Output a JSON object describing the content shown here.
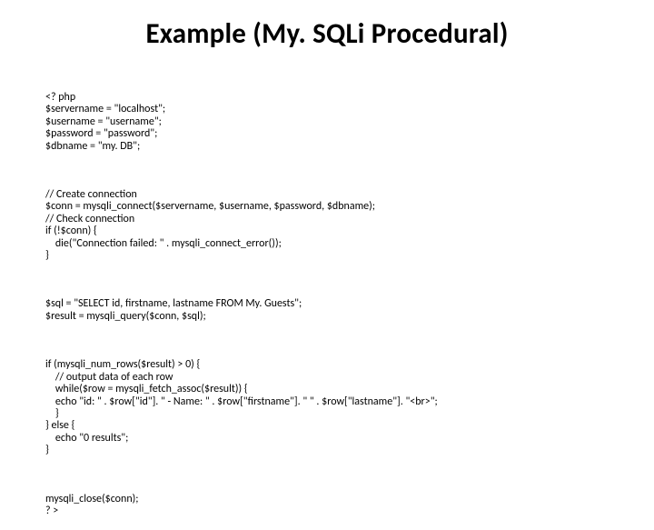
{
  "title": "Example (My. SQLi Procedural)",
  "code": {
    "block1": "<? php\n$servername = \"localhost\";\n$username = \"username\";\n$password = \"password\";\n$dbname = \"my. DB\";",
    "block2": "// Create connection\n$conn = mysqli_connect($servername, $username, $password, $dbname);\n// Check connection\nif (!$conn) {\n    die(\"Connection failed: \" . mysqli_connect_error());\n}",
    "block3": "$sql = \"SELECT id, firstname, lastname FROM My. Guests\";\n$result = mysqli_query($conn, $sql);",
    "block4": "if (mysqli_num_rows($result) > 0) {\n    // output data of each row\n    while($row = mysqli_fetch_assoc($result)) {\n    echo \"id: \" . $row[\"id\"]. \" - Name: \" . $row[\"firstname\"]. \" \" . $row[\"lastname\"]. \"<br>\";\n    }\n} else {\n    echo \"0 results\";\n}",
    "block5": "mysqli_close($conn);\n? >"
  }
}
